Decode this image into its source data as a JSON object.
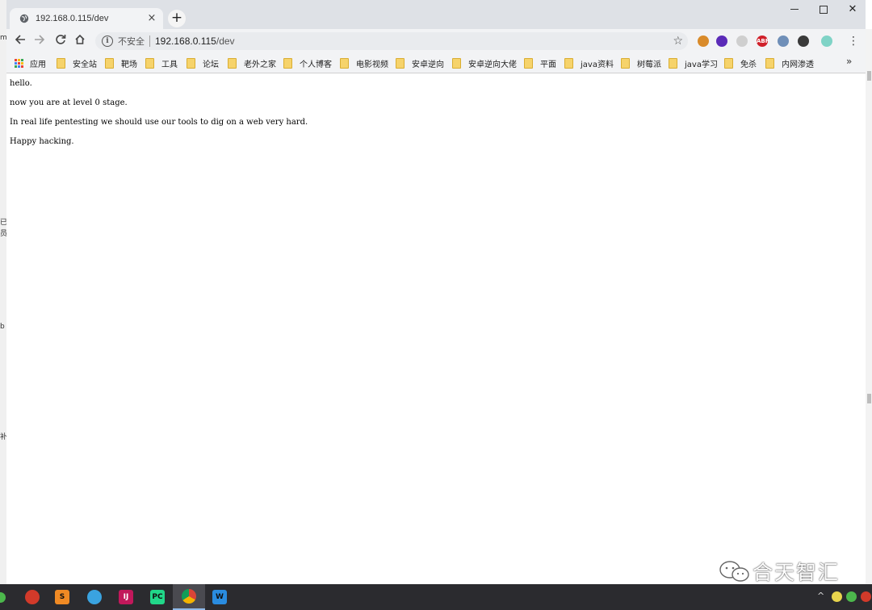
{
  "browser": {
    "tab_title": "192.168.0.115/dev",
    "tab_close": "×",
    "new_tab": "+",
    "window_close": "✕",
    "omnibox": {
      "security_label": "不安全",
      "url_host": "192.168.0.115",
      "url_path": "/dev"
    },
    "bookmarks": [
      {
        "label": "应用",
        "icon": "apps-grid-icon"
      },
      {
        "label": "安全站",
        "icon": "folder-icon"
      },
      {
        "label": "靶场",
        "icon": "folder-icon"
      },
      {
        "label": "工具",
        "icon": "folder-icon"
      },
      {
        "label": "论坛",
        "icon": "folder-icon"
      },
      {
        "label": "老外之家",
        "icon": "folder-icon"
      },
      {
        "label": "个人博客",
        "icon": "folder-icon"
      },
      {
        "label": "电影视频",
        "icon": "folder-icon"
      },
      {
        "label": "安卓逆向",
        "icon": "folder-icon"
      },
      {
        "label": "安卓逆向大佬",
        "icon": "folder-icon"
      },
      {
        "label": "平面",
        "icon": "folder-icon"
      },
      {
        "label": "java资料",
        "icon": "folder-icon"
      },
      {
        "label": "树莓派",
        "icon": "folder-icon"
      },
      {
        "label": "java学习",
        "icon": "folder-icon"
      },
      {
        "label": "免杀",
        "icon": "folder-icon"
      },
      {
        "label": "内网渗透",
        "icon": "folder-icon"
      }
    ],
    "bookmarks_overflow": "»",
    "extensions": [
      {
        "name": "cookie-extension-icon",
        "color": "#d98b2b",
        "text": ""
      },
      {
        "name": "purple-gem-extension-icon",
        "color": "#5b2bb8",
        "text": ""
      },
      {
        "name": "link-extension-icon",
        "color": "#cfcfcf",
        "text": ""
      },
      {
        "name": "adblock-plus-icon",
        "color": "#d0202a",
        "text": "ABP"
      },
      {
        "name": "blue-swirl-extension-icon",
        "color": "#6f8fb8",
        "text": ""
      },
      {
        "name": "gray-circle-extension-icon",
        "color": "#3a3a3a",
        "text": ""
      },
      {
        "name": "teal-shield-extension-icon",
        "color": "#7fd3c6",
        "text": ""
      }
    ]
  },
  "page": {
    "lines": [
      "hello.",
      "now you are at level 0 stage.",
      "In real life pentesting we should use our tools to dig on a web very hard.",
      "Happy hacking."
    ]
  },
  "watermark": {
    "text": "合天智汇"
  },
  "taskbar": {
    "apps": [
      {
        "name": "taskbar-app-red-swirl",
        "color": "#d23a2a",
        "glyph": ""
      },
      {
        "name": "taskbar-app-sublime",
        "color": "#f08a24",
        "glyph": "S"
      },
      {
        "name": "taskbar-app-colorful",
        "color": "#3aa3e0",
        "glyph": ""
      },
      {
        "name": "taskbar-app-intellij",
        "color": "#c2185b",
        "glyph": "IJ"
      },
      {
        "name": "taskbar-app-pycharm",
        "color": "#21d789",
        "glyph": "PC"
      },
      {
        "name": "taskbar-app-chrome",
        "color": "#e8e8e8",
        "glyph": ""
      },
      {
        "name": "taskbar-app-wps",
        "color": "#2a8ce0",
        "glyph": "W"
      }
    ],
    "tray_chevron": "^"
  }
}
